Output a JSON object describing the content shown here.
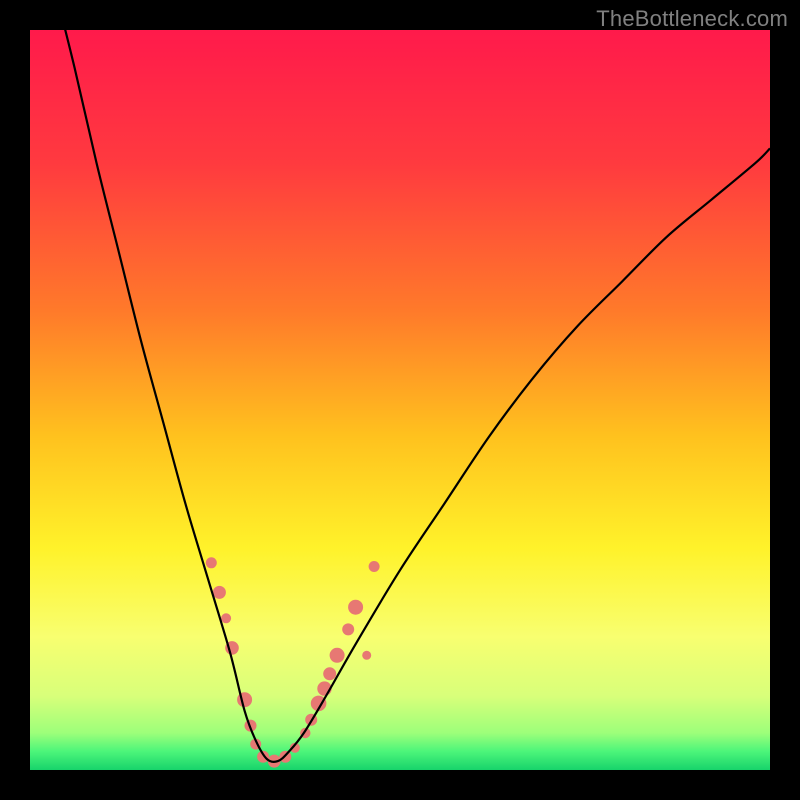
{
  "watermark": "TheBottleneck.com",
  "gradient": {
    "stops": [
      {
        "offset": 0.0,
        "color": "#ff1a4b"
      },
      {
        "offset": 0.18,
        "color": "#ff3a3f"
      },
      {
        "offset": 0.38,
        "color": "#ff7a2a"
      },
      {
        "offset": 0.55,
        "color": "#ffc21e"
      },
      {
        "offset": 0.7,
        "color": "#fff22a"
      },
      {
        "offset": 0.82,
        "color": "#f8ff70"
      },
      {
        "offset": 0.9,
        "color": "#d8ff7a"
      },
      {
        "offset": 0.95,
        "color": "#9dff7a"
      },
      {
        "offset": 0.975,
        "color": "#4cf57a"
      },
      {
        "offset": 1.0,
        "color": "#17d36b"
      }
    ]
  },
  "chart_data": {
    "type": "line",
    "title": "",
    "xlabel": "",
    "ylabel": "",
    "xlim": [
      0,
      100
    ],
    "ylim": [
      0,
      100
    ],
    "series": [
      {
        "name": "bottleneck-curve",
        "x": [
          3,
          6,
          9,
          12,
          15,
          18,
          21,
          24,
          27,
          29,
          30.5,
          32,
          33.5,
          35,
          37,
          40,
          44,
          50,
          56,
          62,
          68,
          74,
          80,
          86,
          92,
          98,
          100
        ],
        "y": [
          107,
          95,
          82,
          70,
          58,
          47,
          36,
          26,
          16,
          8,
          4,
          1.5,
          1.2,
          2.5,
          5,
          10,
          17,
          27,
          36,
          45,
          53,
          60,
          66,
          72,
          77,
          82,
          84
        ]
      }
    ],
    "markers": [
      {
        "x": 24.5,
        "y": 28.0,
        "r": 5.5
      },
      {
        "x": 25.6,
        "y": 24.0,
        "r": 6.5
      },
      {
        "x": 26.5,
        "y": 20.5,
        "r": 5.0
      },
      {
        "x": 27.3,
        "y": 16.5,
        "r": 6.8
      },
      {
        "x": 29.0,
        "y": 9.5,
        "r": 7.5
      },
      {
        "x": 29.8,
        "y": 6.0,
        "r": 6.0
      },
      {
        "x": 30.5,
        "y": 3.5,
        "r": 5.5
      },
      {
        "x": 31.5,
        "y": 1.8,
        "r": 6.0
      },
      {
        "x": 33.0,
        "y": 1.2,
        "r": 6.5
      },
      {
        "x": 34.5,
        "y": 1.8,
        "r": 6.0
      },
      {
        "x": 35.8,
        "y": 3.0,
        "r": 5.0
      },
      {
        "x": 37.2,
        "y": 5.0,
        "r": 5.2
      },
      {
        "x": 38.0,
        "y": 6.8,
        "r": 6.0
      },
      {
        "x": 39.0,
        "y": 9.0,
        "r": 7.8
      },
      {
        "x": 39.8,
        "y": 11.0,
        "r": 7.2
      },
      {
        "x": 40.5,
        "y": 13.0,
        "r": 6.5
      },
      {
        "x": 41.5,
        "y": 15.5,
        "r": 7.5
      },
      {
        "x": 43.0,
        "y": 19.0,
        "r": 6.0
      },
      {
        "x": 44.0,
        "y": 22.0,
        "r": 7.5
      },
      {
        "x": 45.5,
        "y": 15.5,
        "r": 4.5
      },
      {
        "x": 46.5,
        "y": 27.5,
        "r": 5.5
      }
    ],
    "marker_fill": "#e77873",
    "curve_color": "#000000"
  }
}
